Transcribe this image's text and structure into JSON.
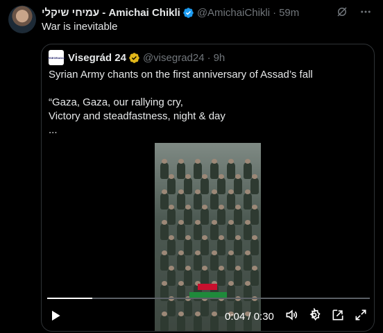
{
  "tweet": {
    "author_name": "עמיחי שיקלי - Amichai Chikli",
    "handle": "@AmichaiChikli",
    "separator": "·",
    "time": "59m",
    "text": "War is inevitable"
  },
  "quote": {
    "logo_text": "VISEGRAD24",
    "author_name": "Visegrád 24",
    "handle": "@visegrad24",
    "separator": "·",
    "time": "9h",
    "text_line1": "Syrian Army chants on the first anniversary of Assad’s fall",
    "text_line2": "“Gaza, Gaza, our rallying cry,\nVictory and steadfastness, night & day\n..."
  },
  "video": {
    "timecode": "0:04 / 0:30",
    "progress": 0.14,
    "icons": [
      "play-icon",
      "volume-icon",
      "settings-icon",
      "pip-icon",
      "fullscreen-icon"
    ]
  },
  "colors": {
    "verified_blue": "#1d9bf0",
    "verified_gold": "#e2b719",
    "secondary_text": "#71767b"
  }
}
